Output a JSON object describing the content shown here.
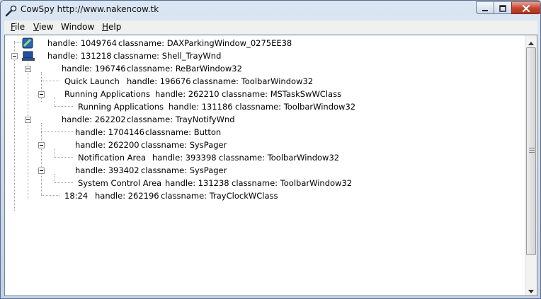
{
  "window": {
    "title": "CowSpy http://www.nakencow.tk",
    "icon": "magnifier-pen-icon",
    "controls": {
      "minimize": "minimize-icon",
      "maximize": "maximize-icon",
      "close": "close-icon"
    }
  },
  "menu": [
    {
      "underline": "F",
      "rest": "ile"
    },
    {
      "underline": "V",
      "rest": "iew"
    },
    {
      "underline": "",
      "rest": "Window"
    },
    {
      "underline": "H",
      "rest": "elp"
    }
  ],
  "tree": {
    "nodes": [
      {
        "label": "handle: 1049764",
        "class_text": "classname: DAXParkingWindow_0275EE38"
      },
      {
        "label": "handle: 131218",
        "class_text": "classname: Shell_TrayWnd"
      },
      {
        "label": "handle: 196746",
        "class_text": "classname: ReBarWindow32"
      },
      {
        "label": "Quick Launch",
        "handle": "handle: 196676",
        "class_text": "classname: ToolbarWindow32"
      },
      {
        "label": "Running Applications",
        "handle": "handle: 262210",
        "class_text": "classname: MSTaskSwWClass"
      },
      {
        "label": "Running Applications",
        "handle": "handle: 131186",
        "class_text": "classname: ToolbarWindow32"
      },
      {
        "label": "handle: 262202",
        "class_text": "classname: TrayNotifyWnd"
      },
      {
        "label": "handle: 1704146",
        "class_text": "classname: Button"
      },
      {
        "label": "handle: 262200",
        "class_text": "classname: SysPager"
      },
      {
        "label": "Notification Area",
        "handle": "handle: 393398",
        "class_text": "classname: ToolbarWindow32"
      },
      {
        "label": "handle: 393402",
        "class_text": "classname: SysPager"
      },
      {
        "label": "System Control Area",
        "handle": "handle: 131238",
        "class_text": "classname: ToolbarWindow32"
      },
      {
        "label": "18:24",
        "handle": "handle: 262196",
        "class_text": "classname: TrayClockWClass"
      }
    ]
  },
  "colors": {
    "accent": "#0a246a",
    "close_red": "#c3432c",
    "selection": "#3399ff"
  }
}
